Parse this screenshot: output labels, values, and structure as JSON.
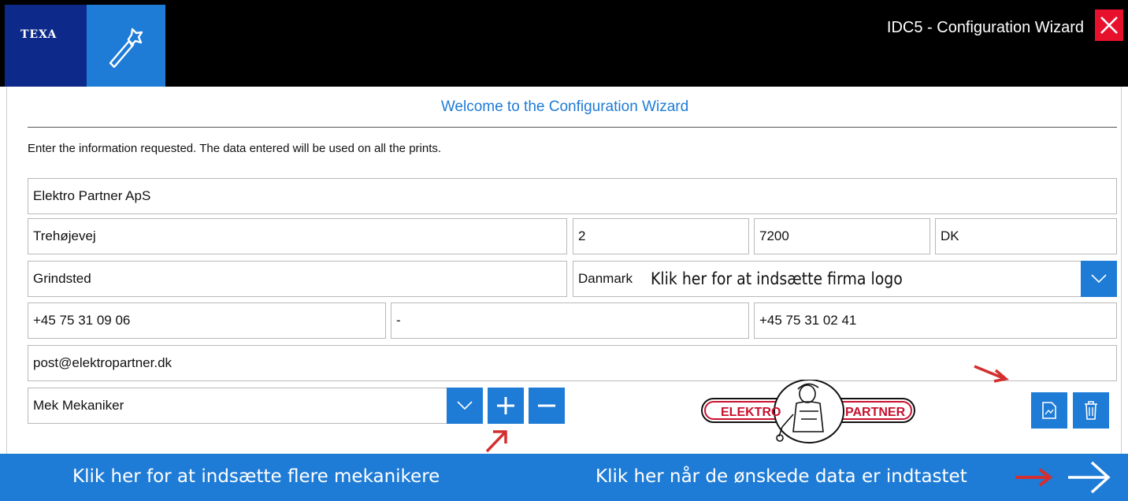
{
  "header": {
    "brand": "TEXA",
    "title": "IDC5 - Configuration Wizard",
    "icons": {
      "wizard": "magic-wand-icon",
      "close": "close-icon"
    }
  },
  "main": {
    "welcome": "Welcome to the Configuration Wizard",
    "instructions": "Enter the information requested. The data entered will be used on all the prints."
  },
  "fields": {
    "company": "Elektro Partner ApS",
    "street": "Trehøjevej",
    "number": "2",
    "postcode": "7200",
    "country_code": "DK",
    "city": "Grindsted",
    "country": "Danmark",
    "phone": "+45 75 31 09 06",
    "mobile": "-",
    "fax": "+45 75 31 02 41",
    "email": "post@elektropartner.dk",
    "mechanic": "Mek Mekaniker"
  },
  "logo": {
    "left": "ELEKTRO",
    "right": "PARTNER"
  },
  "annotations": {
    "logo_hint": "Klik her for at indsætte firma logo",
    "mechanic_hint": "Klik her for at indsætte flere mekanikere",
    "next_hint": "Klik her når de ønskede data er indtastet"
  },
  "colors": {
    "accent": "#1e7bd6",
    "brand": "#0d2a8a",
    "close": "#e8112d",
    "annotation_arrow": "#d32f2f"
  }
}
